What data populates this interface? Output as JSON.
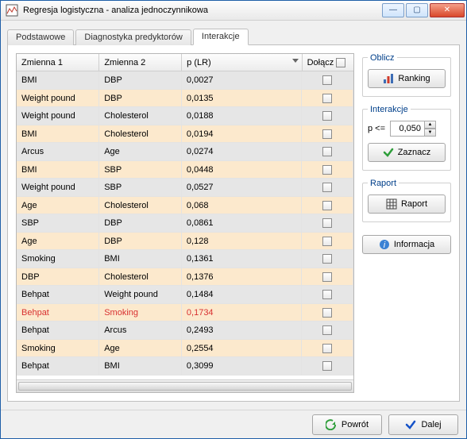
{
  "titlebar": {
    "title": "Regresja logistyczna - analiza jednoczynnikowa"
  },
  "tabs": {
    "t0": "Podstawowe",
    "t1": "Diagnostyka predyktorów",
    "t2": "Interakcje"
  },
  "columns": {
    "c0": "Zmienna 1",
    "c1": "Zmienna 2",
    "c2": "p (LR)",
    "c3": "Dołącz"
  },
  "rows": [
    {
      "v1": "BMI",
      "v2": "DBP",
      "p": "0,0027",
      "hl": false
    },
    {
      "v1": "Weight pound",
      "v2": "DBP",
      "p": "0,0135",
      "hl": false
    },
    {
      "v1": "Weight pound",
      "v2": "Cholesterol",
      "p": "0,0188",
      "hl": false
    },
    {
      "v1": "BMI",
      "v2": "Cholesterol",
      "p": "0,0194",
      "hl": false
    },
    {
      "v1": "Arcus",
      "v2": "Age",
      "p": "0,0274",
      "hl": false
    },
    {
      "v1": "BMI",
      "v2": "SBP",
      "p": "0,0448",
      "hl": false
    },
    {
      "v1": "Weight pound",
      "v2": "SBP",
      "p": "0,0527",
      "hl": false
    },
    {
      "v1": "Age",
      "v2": "Cholesterol",
      "p": "0,068",
      "hl": false
    },
    {
      "v1": "SBP",
      "v2": "DBP",
      "p": "0,0861",
      "hl": false
    },
    {
      "v1": "Age",
      "v2": "DBP",
      "p": "0,128",
      "hl": false
    },
    {
      "v1": "Smoking",
      "v2": "BMI",
      "p": "0,1361",
      "hl": false
    },
    {
      "v1": "DBP",
      "v2": "Cholesterol",
      "p": "0,1376",
      "hl": false
    },
    {
      "v1": "Behpat",
      "v2": "Weight pound",
      "p": "0,1484",
      "hl": false
    },
    {
      "v1": "Behpat",
      "v2": "Smoking",
      "p": "0,1734",
      "hl": true
    },
    {
      "v1": "Behpat",
      "v2": "Arcus",
      "p": "0,2493",
      "hl": false
    },
    {
      "v1": "Smoking",
      "v2": "Age",
      "p": "0,2554",
      "hl": false
    },
    {
      "v1": "Behpat",
      "v2": "BMI",
      "p": "0,3099",
      "hl": false
    }
  ],
  "side": {
    "oblicz_legend": "Oblicz",
    "ranking": "Ranking",
    "interakcje_legend": "Interakcje",
    "p_label": "p <=",
    "p_value": "0,050",
    "zaznacz": "Zaznacz",
    "raport_legend": "Raport",
    "raport": "Raport",
    "informacja": "Informacja"
  },
  "footer": {
    "back": "Powrót",
    "next": "Dalej"
  }
}
